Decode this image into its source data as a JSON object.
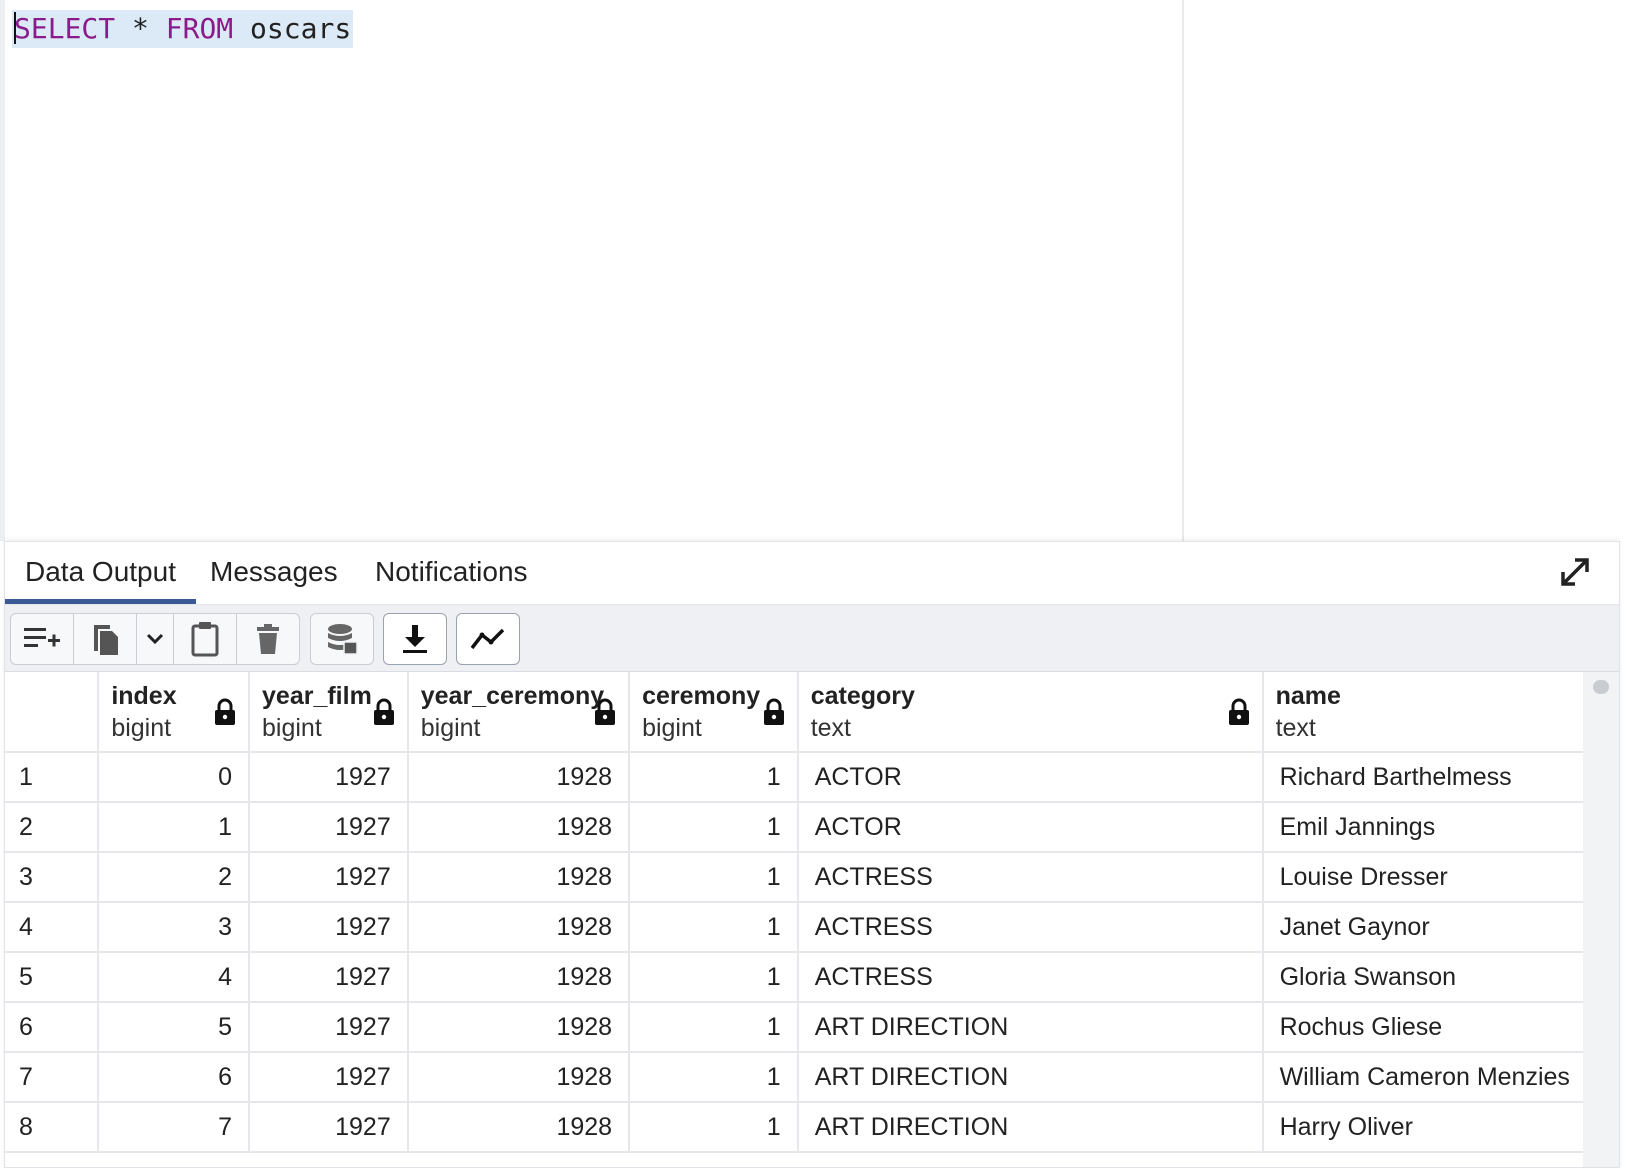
{
  "editor": {
    "keyword_select": "SELECT",
    "star": " * ",
    "keyword_from": "FROM",
    "table_name": " oscars"
  },
  "tabs": [
    {
      "label": "Data Output",
      "active": true
    },
    {
      "label": "Messages",
      "active": false
    },
    {
      "label": "Notifications",
      "active": false
    }
  ],
  "toolbar": {
    "icons": [
      "add-row-icon",
      "copy-icon",
      "chevron-down-icon",
      "paste-icon",
      "delete-icon",
      "save-data-icon",
      "download-icon",
      "graph-icon"
    ]
  },
  "columns": [
    {
      "name": "",
      "type": ""
    },
    {
      "name": "index",
      "type": "bigint",
      "locked": true
    },
    {
      "name": "year_film",
      "type": "bigint",
      "locked": true
    },
    {
      "name": "year_ceremony",
      "type": "bigint",
      "locked": true
    },
    {
      "name": "ceremony",
      "type": "bigint",
      "locked": true
    },
    {
      "name": "category",
      "type": "text",
      "locked": true
    },
    {
      "name": "name",
      "type": "text",
      "locked": false
    }
  ],
  "rows": [
    [
      "1",
      "0",
      "1927",
      "1928",
      "1",
      "ACTOR",
      "Richard Barthelmess"
    ],
    [
      "2",
      "1",
      "1927",
      "1928",
      "1",
      "ACTOR",
      "Emil Jannings"
    ],
    [
      "3",
      "2",
      "1927",
      "1928",
      "1",
      "ACTRESS",
      "Louise Dresser"
    ],
    [
      "4",
      "3",
      "1927",
      "1928",
      "1",
      "ACTRESS",
      "Janet Gaynor"
    ],
    [
      "5",
      "4",
      "1927",
      "1928",
      "1",
      "ACTRESS",
      "Gloria Swanson"
    ],
    [
      "6",
      "5",
      "1927",
      "1928",
      "1",
      "ART DIRECTION",
      "Rochus Gliese"
    ],
    [
      "7",
      "6",
      "1927",
      "1928",
      "1",
      "ART DIRECTION",
      "William Cameron Menzies"
    ],
    [
      "8",
      "7",
      "1927",
      "1928",
      "1",
      "ART DIRECTION",
      "Harry Oliver"
    ]
  ],
  "colors": {
    "accent": "#3a5a96",
    "keyword": "#8b1a8b",
    "selection": "#dce9f6"
  }
}
